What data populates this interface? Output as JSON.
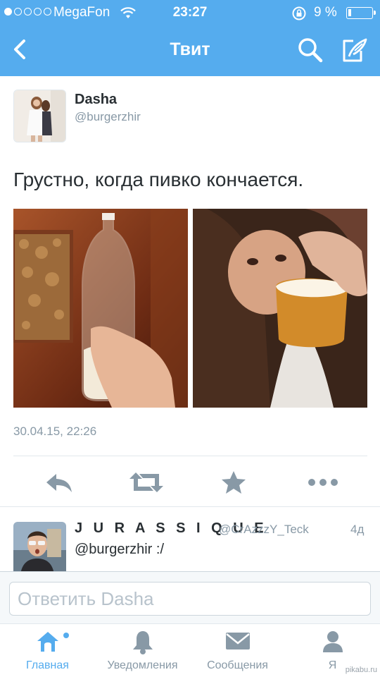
{
  "status_bar": {
    "carrier": "MegaFon",
    "time": "23:27",
    "battery_percent_label": "9 %",
    "battery_level": 0.09,
    "signal_strength": 1,
    "signal_total": 5
  },
  "nav": {
    "title": "Твит",
    "back_icon": "chevron-left-icon",
    "search_icon": "search-icon",
    "compose_icon": "compose-icon"
  },
  "tweet": {
    "display_name": "Dasha",
    "username": "@burgerzhir",
    "text": "Грустно, когда пивко кончается.",
    "timestamp": "30.04.15, 22:26",
    "actions": [
      "reply-icon",
      "retweet-icon",
      "favorite-icon",
      "more-icon"
    ]
  },
  "reply": {
    "display_name": "J U R A S S I Q U E",
    "username": "@CrAzzzY_Teck",
    "time": "4д",
    "text": "@burgerzhir :/"
  },
  "composer": {
    "placeholder": "Ответить Dasha"
  },
  "tabs": [
    {
      "label": "Главная",
      "icon": "home-icon",
      "active": true
    },
    {
      "label": "Уведомления",
      "icon": "bell-icon",
      "active": false
    },
    {
      "label": "Сообщения",
      "icon": "envelope-icon",
      "active": false
    },
    {
      "label": "Я",
      "icon": "person-icon",
      "active": false
    }
  ],
  "watermark": "pikabu.ru",
  "colors": {
    "brand": "#55acee",
    "text": "#292f33",
    "secondary": "#8899a6",
    "icon_gray": "#8899a6"
  }
}
